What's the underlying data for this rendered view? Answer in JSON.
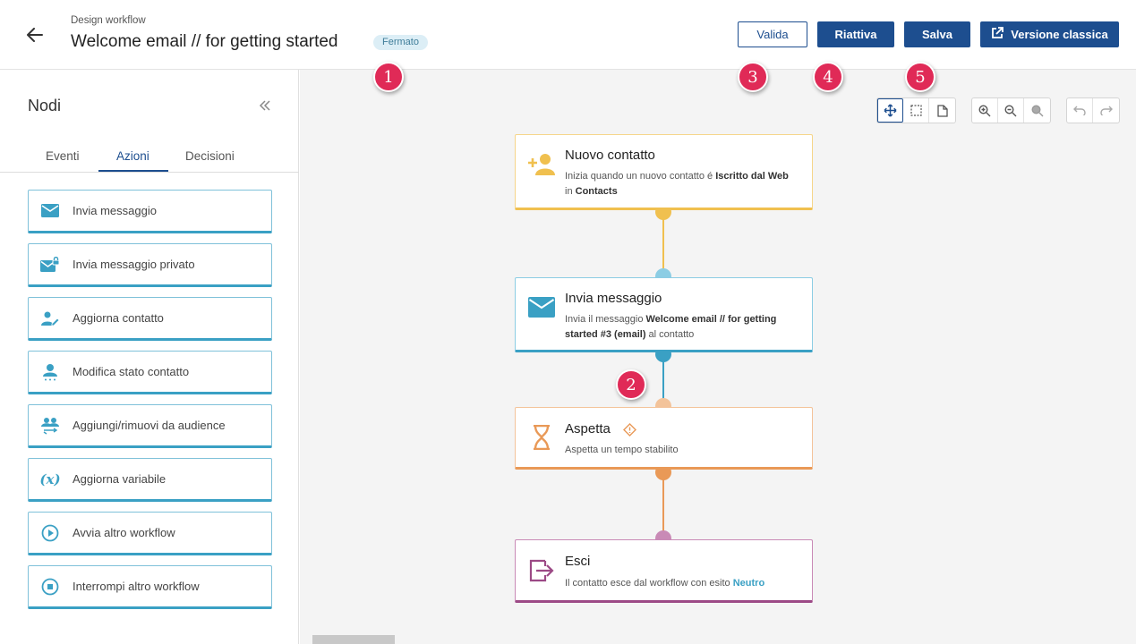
{
  "header": {
    "breadcrumb": "Design workflow",
    "title": "Welcome email // for getting started",
    "status_badge": "Fermato",
    "buttons": {
      "valida": "Valida",
      "riattiva": "Riattiva",
      "salva": "Salva",
      "versione_classica": "Versione classica"
    }
  },
  "sidebar": {
    "title": "Nodi",
    "tabs": [
      "Eventi",
      "Azioni",
      "Decisioni"
    ],
    "active_tab": "Azioni",
    "items": [
      {
        "label": "Invia messaggio",
        "icon": "envelope-icon"
      },
      {
        "label": "Invia messaggio privato",
        "icon": "private-envelope-icon"
      },
      {
        "label": "Aggiorna contatto",
        "icon": "edit-user-icon"
      },
      {
        "label": "Modifica stato contatto",
        "icon": "user-status-icon"
      },
      {
        "label": "Aggiungi/rimuovi da audience",
        "icon": "audience-icon"
      },
      {
        "label": "Aggiorna variabile",
        "icon": "variable-icon"
      },
      {
        "label": "Avvia altro workflow",
        "icon": "play-circle-icon"
      },
      {
        "label": "Interrompi altro workflow",
        "icon": "stop-circle-icon"
      }
    ]
  },
  "canvas": {
    "nodes": [
      {
        "title": "Nuovo contatto",
        "desc_pre": "Inizia quando un nuovo contatto é ",
        "desc_bold1": "Iscritto dal Web",
        "desc_mid": " in ",
        "desc_bold2": "Contacts",
        "icon": "add-user-icon",
        "color": "#f0c04f"
      },
      {
        "title": "Invia messaggio",
        "desc_pre": "Invia il messaggio ",
        "desc_bold1": "Welcome email // for getting started #3 (email)",
        "desc_mid": " al contatto",
        "icon": "envelope-icon",
        "color": "#3aa0c4"
      },
      {
        "title": "Aspetta",
        "desc": "Aspetta un tempo stabilito",
        "icon": "hourglass-icon",
        "warning_icon": "warning-diamond-icon",
        "color": "#e99957"
      },
      {
        "title": "Esci",
        "desc_pre": "Il contatto esce dal workflow con esito ",
        "desc_link": "Neutro",
        "icon": "exit-icon",
        "color": "#9c4a86"
      }
    ],
    "toolbar": {
      "group1": [
        "move-icon",
        "select-area-icon",
        "page-icon"
      ],
      "group2": [
        "zoom-in-icon",
        "zoom-out-icon",
        "zoom-reset-icon"
      ],
      "group3": [
        "undo-icon",
        "redo-icon"
      ]
    }
  },
  "callouts": [
    "1",
    "2",
    "3",
    "4",
    "5"
  ],
  "colors": {
    "primary": "#1d4e8f",
    "callout": "#e02a57",
    "badge_bg": "#dceef6"
  }
}
